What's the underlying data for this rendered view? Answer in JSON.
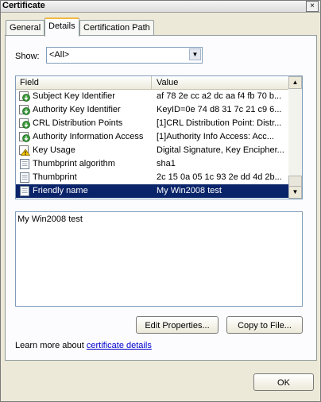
{
  "window": {
    "title": "Certificate",
    "close_glyph": "×"
  },
  "tabs": [
    {
      "label": "General"
    },
    {
      "label": "Details"
    },
    {
      "label": "Certification Path"
    }
  ],
  "show": {
    "label": "Show:",
    "value": "<All>"
  },
  "list": {
    "columns": {
      "field": "Field",
      "value": "Value"
    },
    "rows": [
      {
        "icon": "cert-property-icon",
        "field": "Subject Key Identifier",
        "value": "af 78 2e cc a2 dc aa f4 fb 70 b..."
      },
      {
        "icon": "cert-property-icon",
        "field": "Authority Key Identifier",
        "value": "KeyID=0e 74 d8 31 7c 21 c9 6..."
      },
      {
        "icon": "cert-property-icon",
        "field": "CRL Distribution Points",
        "value": "[1]CRL Distribution Point: Distr..."
      },
      {
        "icon": "cert-property-icon",
        "field": "Authority Information Access",
        "value": "[1]Authority Info Access: Acc..."
      },
      {
        "icon": "warning-icon",
        "field": "Key Usage",
        "value": "Digital Signature, Key Encipher..."
      },
      {
        "icon": "document-icon",
        "field": "Thumbprint algorithm",
        "value": "sha1"
      },
      {
        "icon": "document-icon",
        "field": "Thumbprint",
        "value": "2c 15 0a 05 1c 93 2e dd 4d 2b..."
      },
      {
        "icon": "document-icon",
        "field": "Friendly name",
        "value": "My Win2008 test",
        "selected": true
      }
    ]
  },
  "detail_value": "My Win2008 test",
  "buttons": {
    "edit_properties": "Edit Properties...",
    "copy_to_file": "Copy to File...",
    "ok": "OK"
  },
  "learn_more": {
    "prefix": "Learn more about ",
    "link": "certificate details"
  },
  "colors": {
    "selection": "#0a246a",
    "link": "#0000cc",
    "tab_highlight": "#f1b746"
  }
}
